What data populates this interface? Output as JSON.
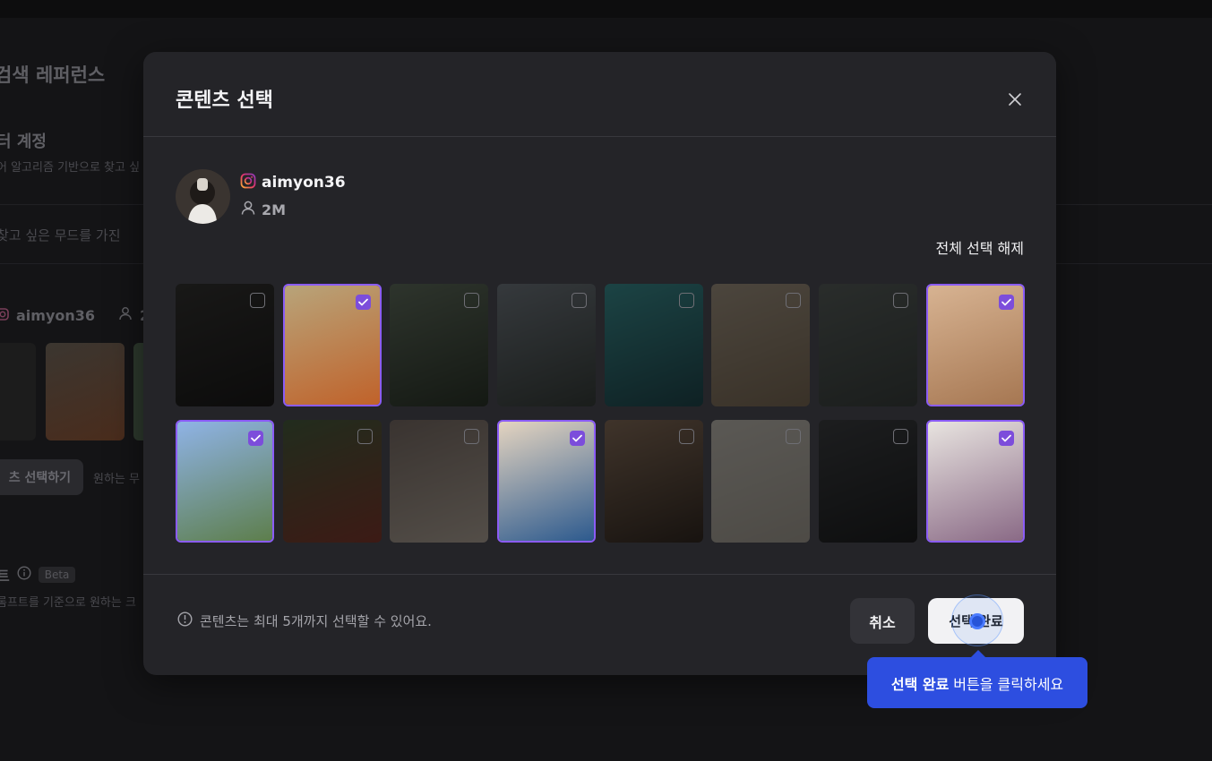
{
  "background": {
    "page_title": "검색 레퍼런스",
    "section_title": "터 계정",
    "section_desc": "어 알고리즘 기반으로 찾고 싶",
    "input_placeholder": "찾고 싶은 무드를 가진",
    "account_handle": "aimyon36",
    "account_followers": "2",
    "select_button_label": "츠 선택하기",
    "select_hint": "원하는 무",
    "prompt_title": "트",
    "beta_badge": "Beta",
    "prompt_desc": "롬프트를 기준으로 원하는 크"
  },
  "modal": {
    "title": "콘텐츠 선택",
    "account": {
      "handle": "aimyon36",
      "followers": "2M",
      "platform_icon": "instagram-icon"
    },
    "deselect_all_label": "전체 선택 해제",
    "tiles": [
      {
        "selected": false,
        "colors": [
          "#3a3936",
          "#1d1c1b"
        ]
      },
      {
        "selected": true,
        "colors": [
          "#b8a47a",
          "#c0622a"
        ]
      },
      {
        "selected": false,
        "colors": [
          "#6a7d66",
          "#2e3b2b"
        ]
      },
      {
        "selected": false,
        "colors": [
          "#7d8892",
          "#3c4540"
        ]
      },
      {
        "selected": false,
        "colors": [
          "#2fa5a8",
          "#1a5058"
        ]
      },
      {
        "selected": false,
        "colors": [
          "#b7a58c",
          "#8c7558"
        ]
      },
      {
        "selected": false,
        "colors": [
          "#616b66",
          "#3f4744"
        ]
      },
      {
        "selected": true,
        "colors": [
          "#d7b392",
          "#a67752"
        ]
      },
      {
        "selected": true,
        "colors": [
          "#8fb3e6",
          "#5d7e4c"
        ]
      },
      {
        "selected": false,
        "colors": [
          "#4c6b3e",
          "#a03a2a"
        ]
      },
      {
        "selected": false,
        "colors": [
          "#8c7a70",
          "#c9b9a8"
        ]
      },
      {
        "selected": true,
        "colors": [
          "#e4d4c0",
          "#2d5a8e"
        ]
      },
      {
        "selected": false,
        "colors": [
          "#9c7a5e",
          "#3a2c22"
        ]
      },
      {
        "selected": false,
        "colors": [
          "#d8d2c6",
          "#b9b1a2"
        ]
      },
      {
        "selected": false,
        "colors": [
          "#43464a",
          "#1f2123"
        ]
      },
      {
        "selected": true,
        "colors": [
          "#e8e4e0",
          "#8a6a86"
        ]
      }
    ],
    "notice": "콘텐츠는 최대 5개까지 선택할 수 있어요.",
    "cancel_label": "취소",
    "done_label": "선택 완료"
  },
  "guide": {
    "emphasis": "선택 완료",
    "text": "버튼을 클릭하세요",
    "accent_color": "#2d4ee0"
  },
  "colors": {
    "selection_accent": "#8b5cf6",
    "modal_bg": "#242428"
  }
}
